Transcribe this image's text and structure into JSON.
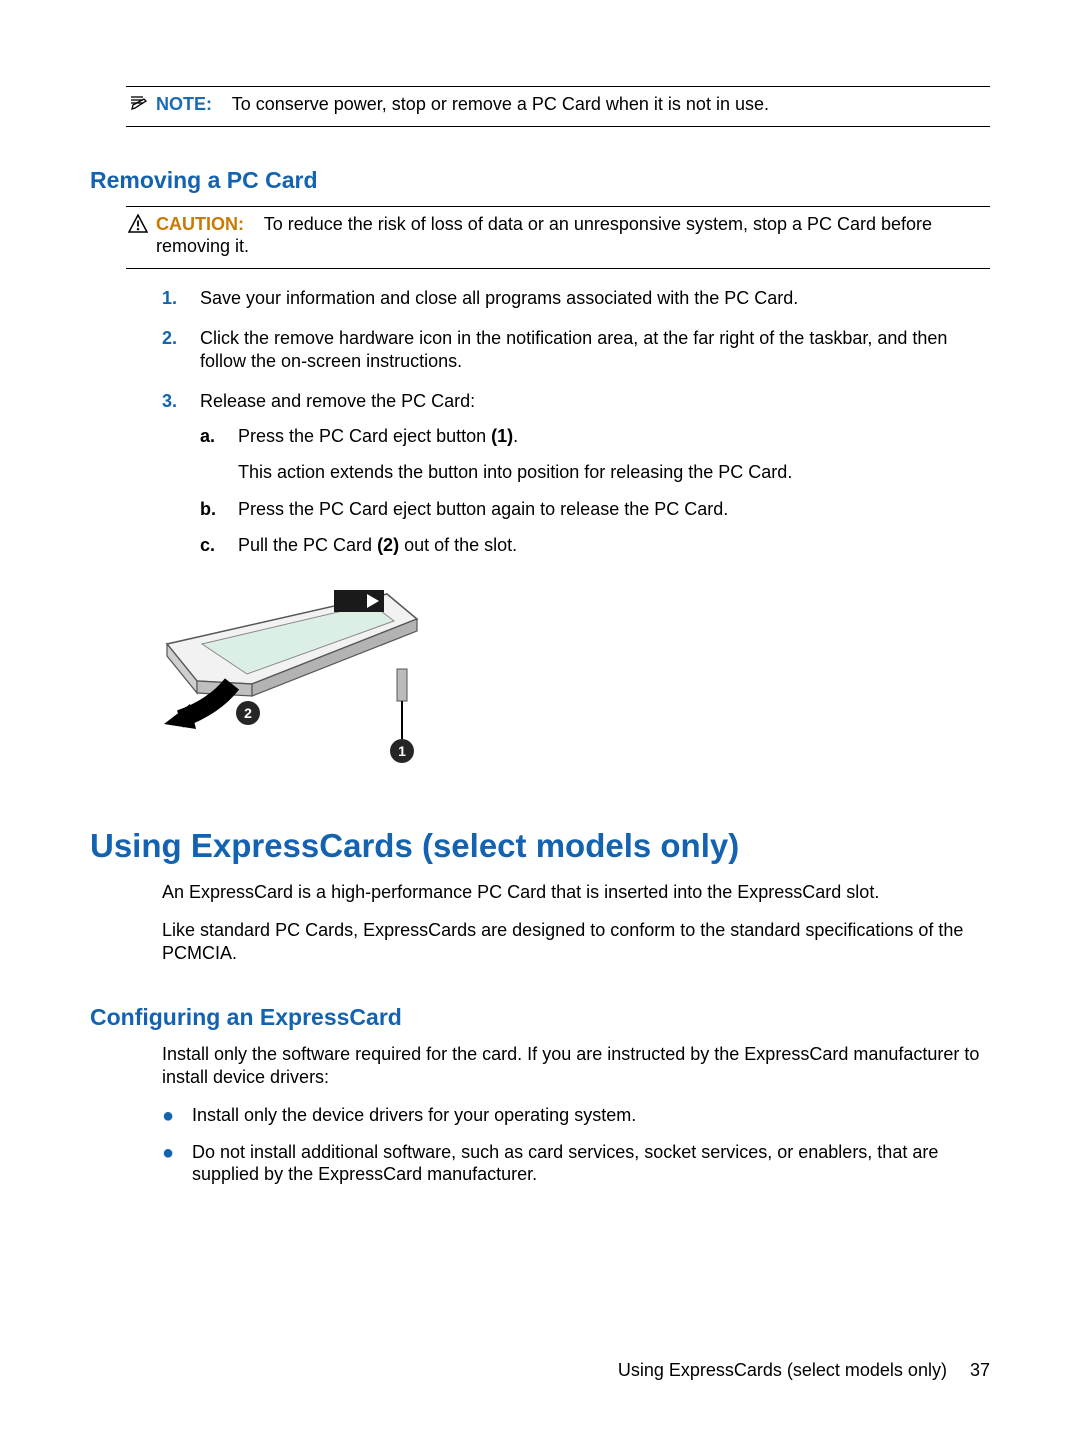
{
  "note": {
    "label": "NOTE:",
    "text": "To conserve power, stop or remove a PC Card when it is not in use."
  },
  "heading_remove": "Removing a PC Card",
  "caution": {
    "label": "CAUTION:",
    "text": "To reduce the risk of loss of data or an unresponsive system, stop a PC Card before removing it."
  },
  "steps": {
    "s1": {
      "marker": "1.",
      "text": "Save your information and close all programs associated with the PC Card."
    },
    "s2": {
      "marker": "2.",
      "text": "Click the remove hardware icon in the notification area, at the far right of the taskbar, and then follow the on-screen instructions."
    },
    "s3": {
      "marker": "3.",
      "text": "Release and remove the PC Card:"
    }
  },
  "substeps": {
    "a": {
      "marker": "a.",
      "pre": "Press the PC Card eject button ",
      "bold": "(1)",
      "post": ".",
      "sub_para": "This action extends the button into position for releasing the PC Card."
    },
    "b": {
      "marker": "b.",
      "text": "Press the PC Card eject button again to release the PC Card."
    },
    "c": {
      "marker": "c.",
      "pre": "Pull the PC Card ",
      "bold": "(2)",
      "post": " out of the slot."
    }
  },
  "illustration": {
    "callout1": "1",
    "callout2": "2"
  },
  "heading_express_h1": "Using ExpressCards (select models only)",
  "express_p1": "An ExpressCard is a high-performance PC Card that is inserted into the ExpressCard slot.",
  "express_p2": "Like standard PC Cards, ExpressCards are designed to conform to the standard specifications of the PCMCIA.",
  "heading_config": "Configuring an ExpressCard",
  "config_p1": "Install only the software required for the card. If you are instructed by the ExpressCard manufacturer to install device drivers:",
  "config_bullets": {
    "b1": "Install only the device drivers for your operating system.",
    "b2": "Do not install additional software, such as card services, socket services, or enablers, that are supplied by the ExpressCard manufacturer."
  },
  "footer": {
    "title": "Using ExpressCards (select models only)",
    "page": "37"
  }
}
